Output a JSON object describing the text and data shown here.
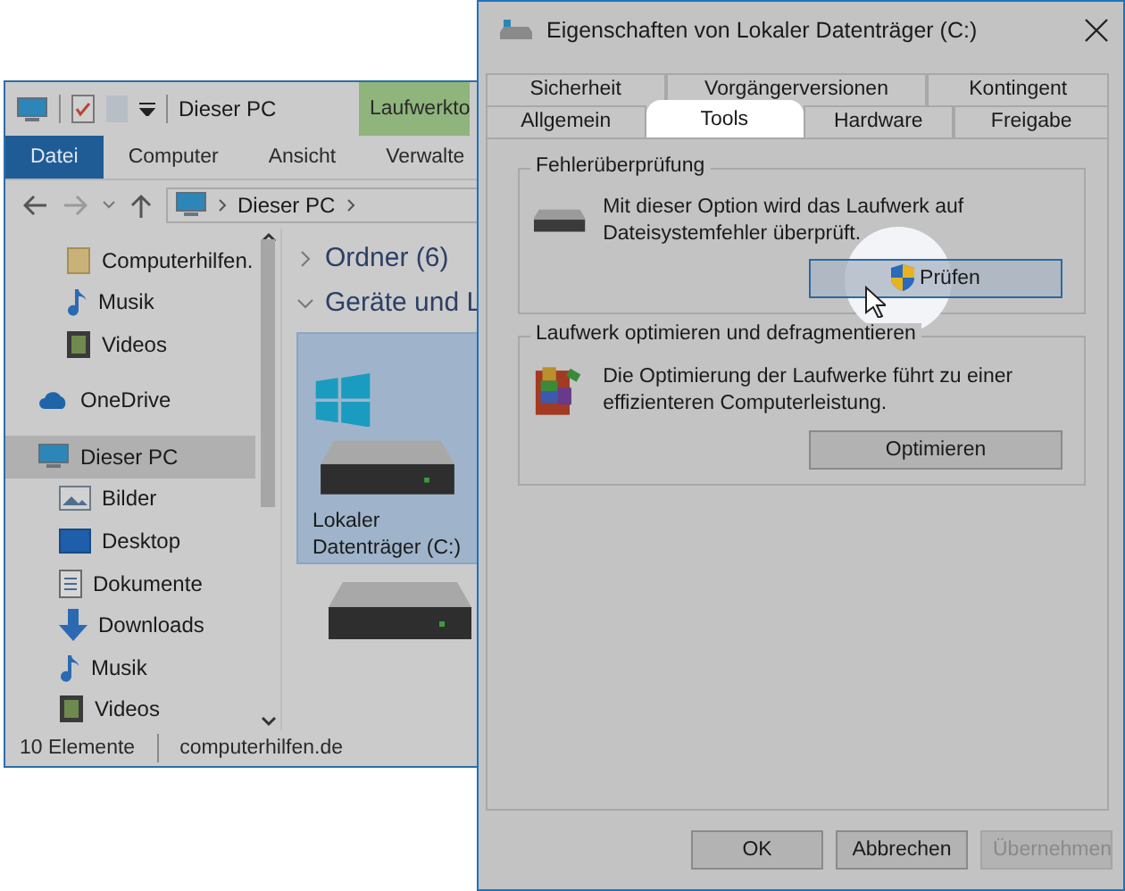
{
  "explorer": {
    "title": "Dieser PC",
    "context_tab": "Laufwerkto",
    "ribbon_tabs": [
      {
        "label": "Datei",
        "selected": true
      },
      {
        "label": "Computer",
        "selected": false
      },
      {
        "label": "Ansicht",
        "selected": false
      },
      {
        "label": "Verwalte",
        "selected": false
      }
    ],
    "address": "Dieser PC",
    "nav": [
      {
        "label": "Computerhilfen.",
        "kind": "folder",
        "selected": false
      },
      {
        "label": "Musik",
        "kind": "music",
        "selected": false
      },
      {
        "label": "Videos",
        "kind": "video",
        "selected": false
      },
      {
        "label": "OneDrive",
        "kind": "cloud",
        "selected": false
      },
      {
        "label": "Dieser PC",
        "kind": "pc",
        "selected": true,
        "children": [
          {
            "label": "Bilder",
            "kind": "pictures",
            "selected": false
          },
          {
            "label": "Desktop",
            "kind": "desktop",
            "selected": false
          },
          {
            "label": "Dokumente",
            "kind": "document",
            "selected": false
          },
          {
            "label": "Downloads",
            "kind": "download",
            "selected": false
          },
          {
            "label": "Musik",
            "kind": "music",
            "selected": false
          },
          {
            "label": "Videos",
            "kind": "video",
            "selected": false
          }
        ]
      }
    ],
    "sections": [
      {
        "label": "Ordner (6)",
        "expanded": false
      },
      {
        "label": "Geräte und L",
        "expanded": true
      }
    ],
    "drive": {
      "label": "Lokaler Datenträger (C:)",
      "selected": true
    },
    "status": [
      "10 Elemente",
      "computerhilfen.de"
    ]
  },
  "dialog": {
    "title": "Eigenschaften von Lokaler Datenträger (C:)",
    "tab_rows": [
      [
        {
          "label": "Sicherheit",
          "selected": false
        },
        {
          "label": "Vorgängerversionen",
          "selected": false
        },
        {
          "label": "Kontingent",
          "selected": false
        }
      ],
      [
        {
          "label": "Allgemein",
          "selected": false
        },
        {
          "label": "Tools",
          "selected": true
        },
        {
          "label": "Hardware",
          "selected": false
        },
        {
          "label": "Freigabe",
          "selected": false
        }
      ]
    ],
    "groups": [
      {
        "title": "Fehlerüberprüfung",
        "kind": "check",
        "text": "Mit dieser Option wird das Laufwerk auf Dateisystemfehler überprüft.",
        "button": "Prüfen",
        "highlighted": true
      },
      {
        "title": "Laufwerk optimieren und defragmentieren",
        "kind": "defrag",
        "text": "Die Optimierung der Laufwerke führt zu einer effizienteren Computerleistung.",
        "button": "Optimieren",
        "highlighted": false
      }
    ],
    "buttons": [
      {
        "label": "OK",
        "disabled": false
      },
      {
        "label": "Abbrechen",
        "disabled": false
      },
      {
        "label": "Übernehmen",
        "disabled": true
      }
    ]
  }
}
